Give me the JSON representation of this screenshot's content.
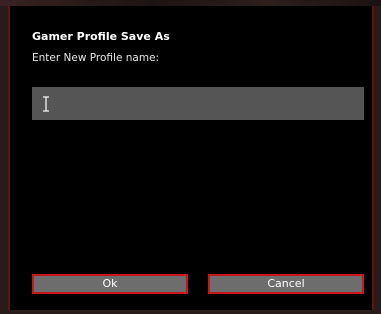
{
  "dialog": {
    "title": "Gamer Profile Save As",
    "prompt": "Enter New Profile name:",
    "input": {
      "value": "",
      "cursor_icon": "text-cursor-icon"
    },
    "buttons": {
      "ok_label": "Ok",
      "cancel_label": "Cancel"
    }
  },
  "colors": {
    "dialog_background": "#000000",
    "input_background": "#555555",
    "button_background": "#6d6d6d",
    "button_border": "#c8161e",
    "text": "#ffffff"
  }
}
